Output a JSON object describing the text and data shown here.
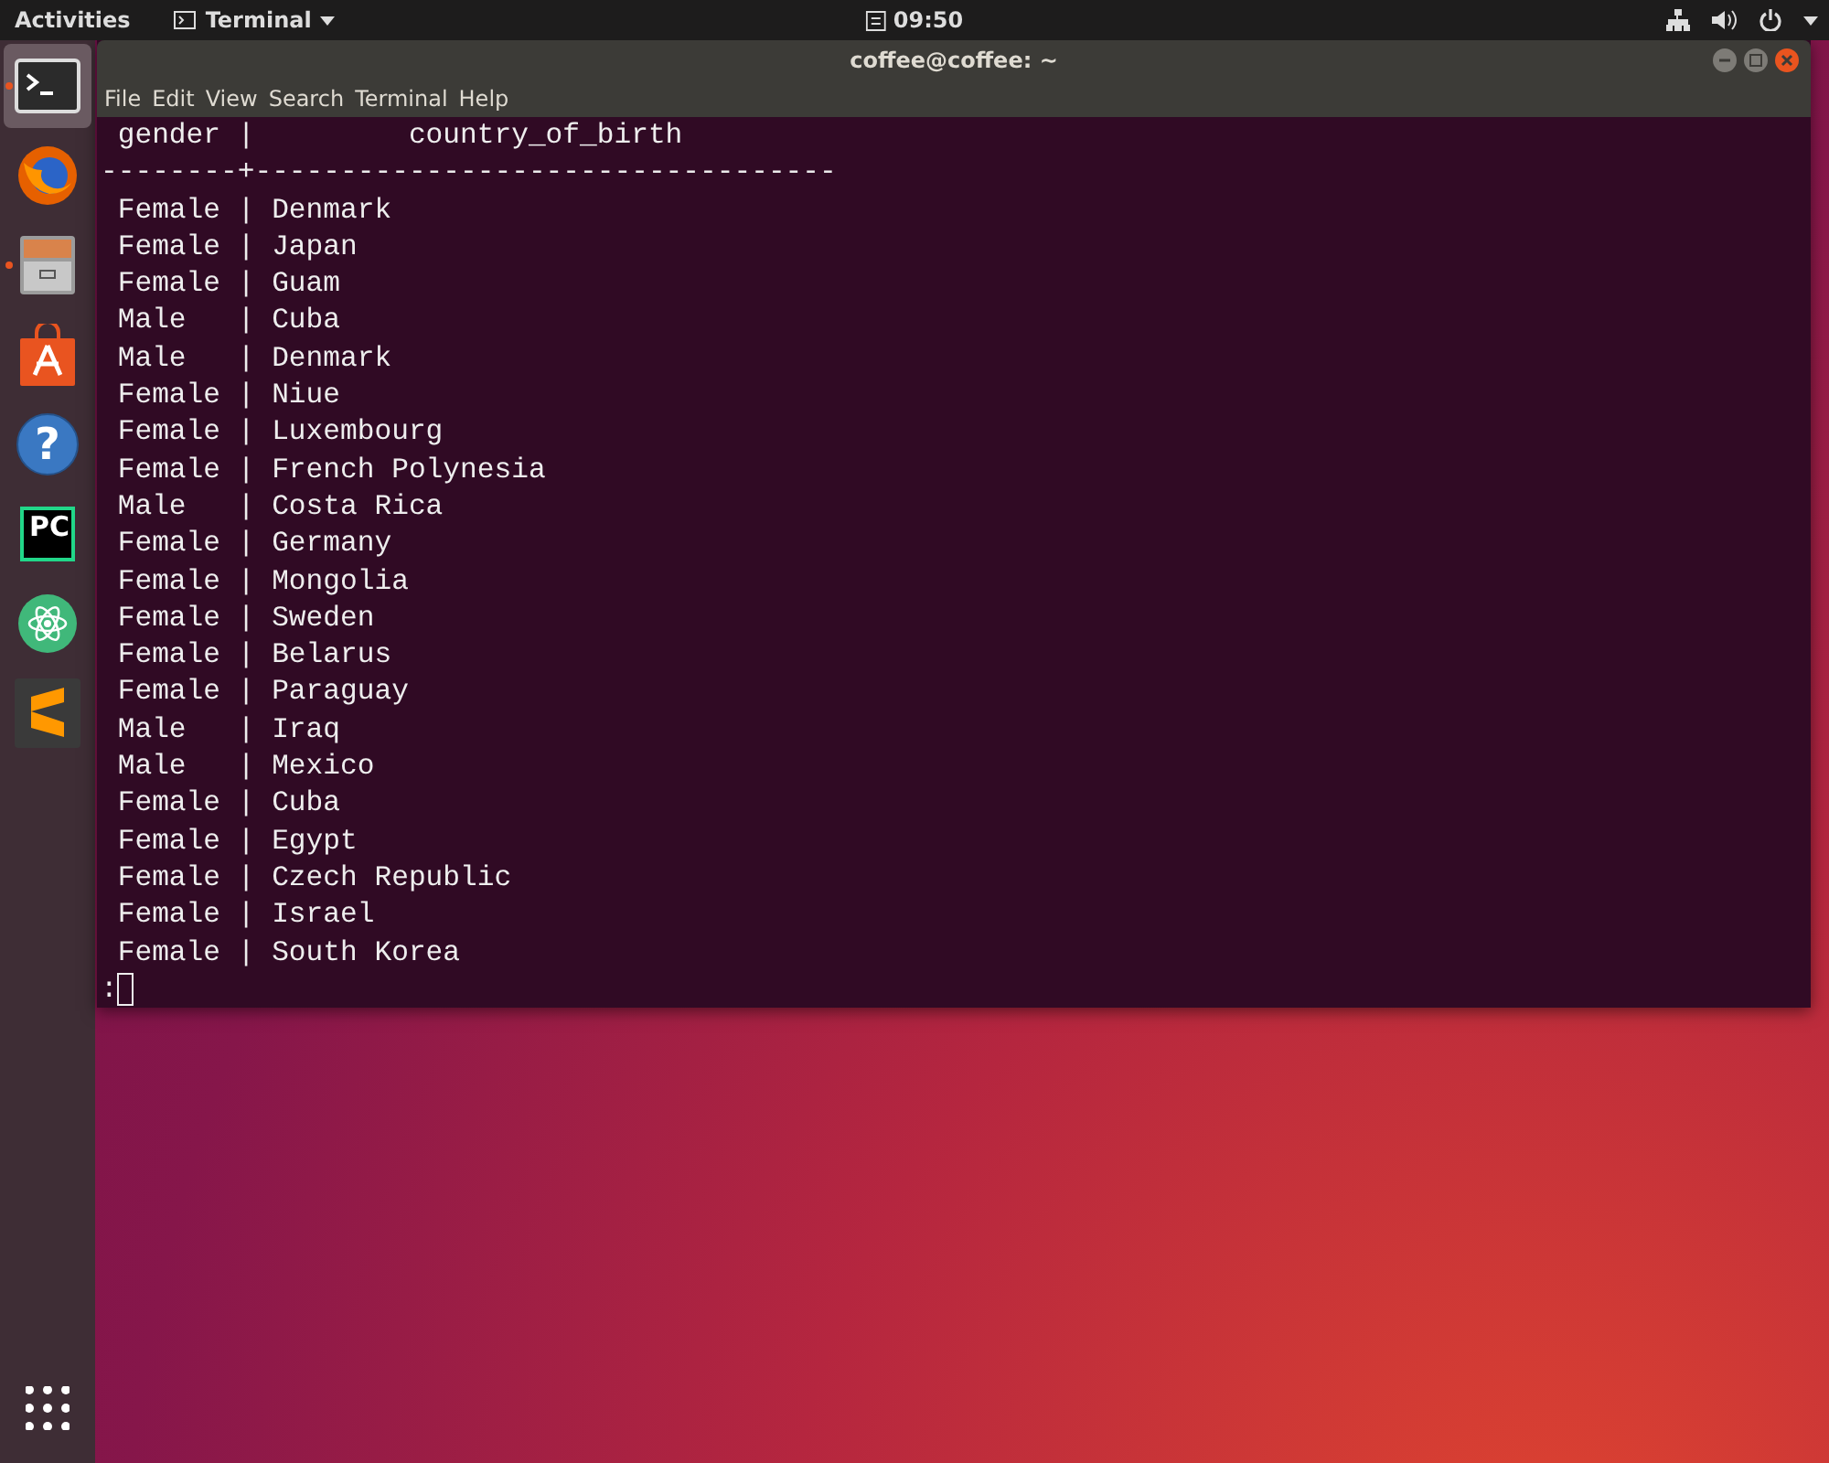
{
  "top_bar": {
    "activities": "Activities",
    "app_menu": "Terminal",
    "clock": "09:50"
  },
  "dock": [
    {
      "kind": "terminal",
      "running": true,
      "selected": true
    },
    {
      "kind": "firefox",
      "running": false,
      "selected": false
    },
    {
      "kind": "files",
      "running": true,
      "selected": false
    },
    {
      "kind": "software",
      "running": false,
      "selected": false
    },
    {
      "kind": "help",
      "running": false,
      "selected": false,
      "glyph": "?"
    },
    {
      "kind": "pycharm",
      "running": false,
      "selected": false,
      "glyph": "PC"
    },
    {
      "kind": "atom",
      "running": false,
      "selected": false
    },
    {
      "kind": "sublime",
      "running": false,
      "selected": false
    }
  ],
  "window": {
    "title": "coffee@coffee: ~",
    "menu": [
      "File",
      "Edit",
      "View",
      "Search",
      "Terminal",
      "Help"
    ],
    "terminal": {
      "lines": [
        " gender |         country_of_birth",
        "--------+----------------------------------",
        " Female | Denmark",
        " Female | Japan",
        " Female | Guam",
        " Male   | Cuba",
        " Male   | Denmark",
        " Female | Niue",
        " Female | Luxembourg",
        " Female | French Polynesia",
        " Male   | Costa Rica",
        " Female | Germany",
        " Female | Mongolia",
        " Female | Sweden",
        " Female | Belarus",
        " Female | Paraguay",
        " Male   | Iraq",
        " Male   | Mexico",
        " Female | Cuba",
        " Female | Egypt",
        " Female | Czech Republic",
        " Female | Israel",
        " Female | South Korea"
      ],
      "prompt": ":"
    }
  }
}
